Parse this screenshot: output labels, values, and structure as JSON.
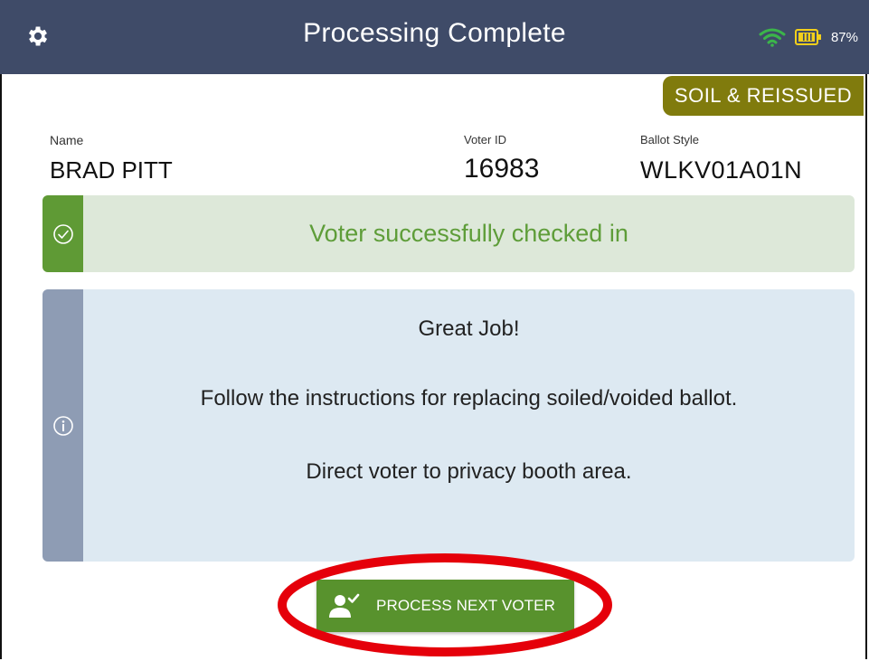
{
  "header": {
    "title": "Processing Complete",
    "battery_percent": "87%",
    "icons": [
      "gear-icon",
      "wifi-icon",
      "battery-icon"
    ]
  },
  "badge": "SOIL & REISSUED",
  "voter": {
    "name_label": "Name",
    "name": "BRAD PITT",
    "voter_id_label": "Voter ID",
    "voter_id": "16983",
    "ballot_style_label": "Ballot Style",
    "ballot_style": "WLKV01A01N"
  },
  "success": {
    "message": "Voter successfully checked in",
    "icon": "check-circle-icon"
  },
  "info": {
    "icon": "info-circle-icon",
    "lines": [
      "Great Job!",
      "Follow the instructions for replacing soiled/voided ballot.",
      "Direct voter to privacy booth area."
    ]
  },
  "action": {
    "button_label": "PROCESS NEXT VOTER",
    "icon": "voter-check-icon"
  },
  "colors": {
    "header_bg": "#3f4b68",
    "badge_bg": "#807b0d",
    "success_bg": "#dde8d9",
    "success_accent": "#5f9a35",
    "info_bg": "#dde9f2",
    "info_accent": "#8e9cb4",
    "button_bg": "#58922d",
    "highlight_ring": "#e5000a"
  }
}
